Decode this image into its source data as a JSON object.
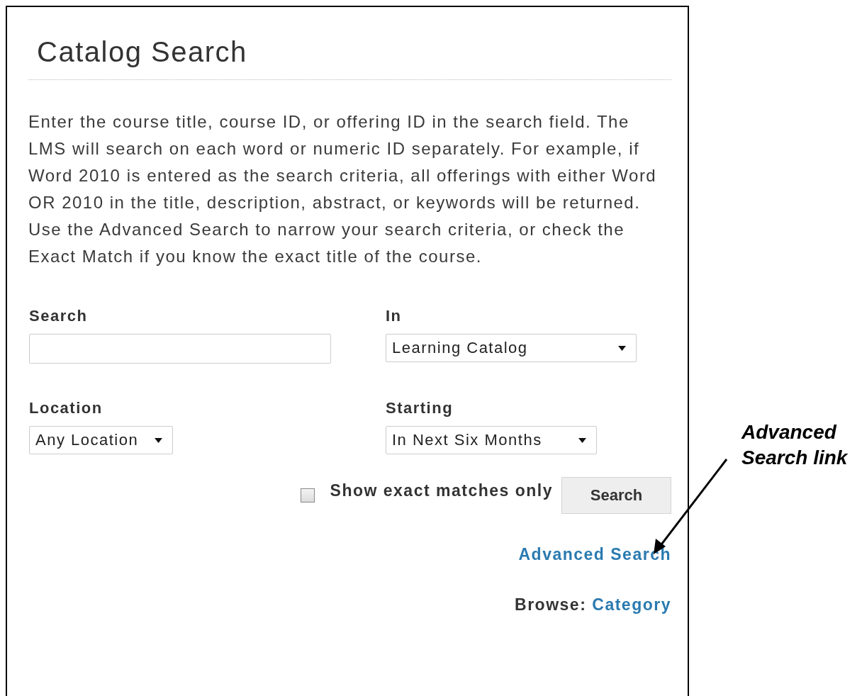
{
  "title": "Catalog Search",
  "intro": "Enter the course title, course ID, or offering ID in the search field. The LMS will search on each word or numeric ID separately. For example, if Word 2010 is entered as the search criteria, all offerings with either Word OR 2010 in the title, description, abstract, or keywords will be returned. Use the Advanced Search to narrow your search criteria, or check the Exact Match if you know the exact title of the course.",
  "fields": [
    {
      "kind": "input",
      "label": "Search"
    },
    {
      "kind": "select",
      "label": "In",
      "value": "Learning Catalog"
    },
    {
      "kind": "select",
      "label": "Location",
      "value": "Any Location"
    },
    {
      "kind": "select",
      "label": "Starting",
      "value": "In Next Six Months"
    }
  ],
  "exact_match": {
    "label": "Show exact matches only",
    "checked": false
  },
  "search_button": "Search",
  "advanced_link": "Advanced Search",
  "browse": {
    "label": "Browse:",
    "link": "Category"
  },
  "annotation": "Advanced Search link"
}
